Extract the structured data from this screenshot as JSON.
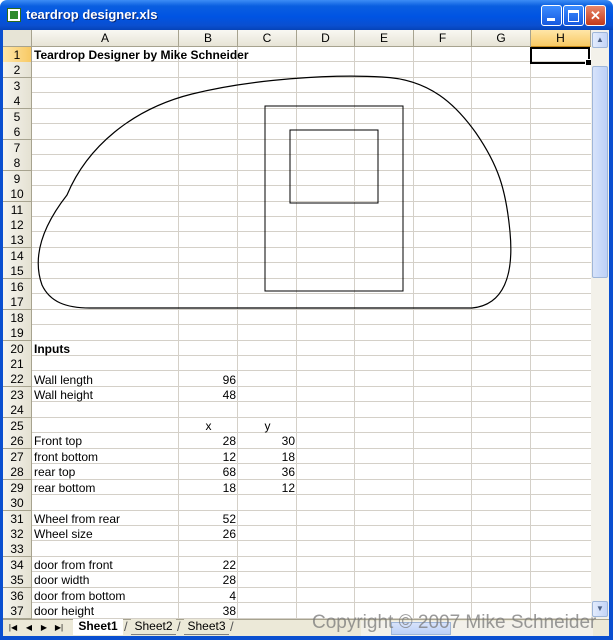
{
  "window": {
    "title": "teardrop designer.xls"
  },
  "columns": [
    "A",
    "B",
    "C",
    "D",
    "E",
    "F",
    "G",
    "H"
  ],
  "active_column": "H",
  "active_row": "1",
  "rows": [
    "1",
    "2",
    "3",
    "4",
    "5",
    "6",
    "7",
    "8",
    "9",
    "10",
    "11",
    "12",
    "13",
    "14",
    "15",
    "16",
    "17",
    "18",
    "19",
    "20",
    "21",
    "22",
    "23",
    "24",
    "25",
    "26",
    "27",
    "28",
    "29",
    "30",
    "31",
    "32",
    "33",
    "34",
    "35",
    "36",
    "37"
  ],
  "cells": {
    "a1": "Teardrop Designer by Mike Schneider",
    "a20": "Inputs",
    "a22": "Wall length",
    "b22": "96",
    "a23": "Wall height",
    "b23": "48",
    "b25": "x",
    "c25": "y",
    "a26": "Front top",
    "b26": "28",
    "c26": "30",
    "a27": "front bottom",
    "b27": "12",
    "c27": "18",
    "a28": "rear top",
    "b28": "68",
    "c28": "36",
    "a29": "rear bottom",
    "b29": "18",
    "c29": "12",
    "a31": "Wheel from rear",
    "b31": "52",
    "a32": "Wheel size",
    "b32": "26",
    "a34": "door from front",
    "b34": "22",
    "a35": "door width",
    "b35": "28",
    "a36": "door from bottom",
    "b36": "4",
    "a37": "door height",
    "b37": "38"
  },
  "sheet_tabs": [
    "Sheet1",
    "Sheet2",
    "Sheet3"
  ],
  "active_sheet": "Sheet1",
  "watermark": "Copyright © 2007 Mike Schneider",
  "icons": [
    "excel-file-icon",
    "minimize-icon",
    "maximize-icon",
    "close-icon",
    "scroll-up-arrow-icon",
    "scroll-down-arrow-icon",
    "first-sheet-icon",
    "previous-sheet-icon",
    "next-sheet-icon",
    "last-sheet-icon"
  ],
  "colors": {
    "titlebar": "#0054e3",
    "grid_line": "#d4d0c8",
    "header_bg": "#ece9d8",
    "active_header": "#f8c964"
  }
}
